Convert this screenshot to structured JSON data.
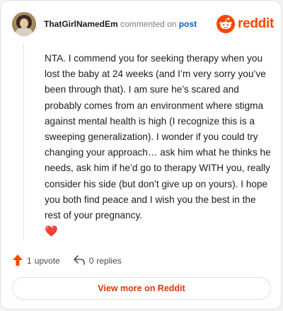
{
  "header": {
    "username": "ThatGirlNamedEm",
    "action_text": "commented on",
    "post_link": "post",
    "logo_text": "reddit"
  },
  "comment": {
    "body": "NTA. I commend you for seeking therapy when you lost the baby at 24 weeks (and I’m very sorry you’ve been through that). I am sure he’s scared and probably comes from an environment where stigma against mental health is high (I recognize this is a sweeping generalization). I wonder if you could try changing your approach… ask him what he thinks he needs, ask him if he’d go to therapy WITH you, really consider his side (but don’t give up on yours). I hope you both find peace and I wish you the best in the rest of your pregnancy.",
    "emoji": "❤️"
  },
  "actions": {
    "upvote_count": "1",
    "upvote_label": "upvote",
    "reply_count": "0",
    "reply_label": "replies"
  },
  "footer": {
    "view_more_label": "View more on Reddit"
  },
  "colors": {
    "brand": "#ff4500",
    "link": "#0a5fc2",
    "view_more": "#d93a00"
  },
  "icons": [
    "avatar",
    "reddit-snoo-icon",
    "upvote-arrow-icon",
    "reply-arrow-icon"
  ]
}
